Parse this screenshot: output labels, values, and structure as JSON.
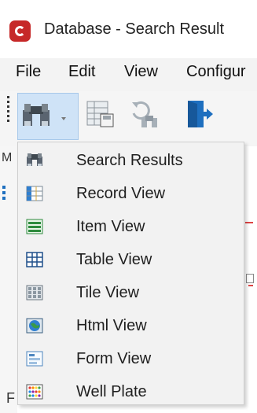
{
  "window": {
    "title": "Database - Search Result"
  },
  "menubar": {
    "items": [
      "File",
      "Edit",
      "View",
      "Configur"
    ]
  },
  "left_edge": {
    "m": "M",
    "f": "F"
  },
  "dropdown": {
    "items": [
      {
        "label": "Search Results",
        "icon": "binoculars-icon"
      },
      {
        "label": "Record View",
        "icon": "record-view-icon"
      },
      {
        "label": "Item View",
        "icon": "item-view-icon"
      },
      {
        "label": "Table View",
        "icon": "table-view-icon"
      },
      {
        "label": "Tile View",
        "icon": "tile-view-icon"
      },
      {
        "label": "Html View",
        "icon": "html-view-icon"
      },
      {
        "label": "Form View",
        "icon": "form-view-icon"
      },
      {
        "label": "Well Plate",
        "icon": "well-plate-icon"
      }
    ]
  },
  "colors": {
    "brand": "#c62828",
    "active_toolbar": "#cfe3f7",
    "accent_blue": "#1e6fbf"
  }
}
